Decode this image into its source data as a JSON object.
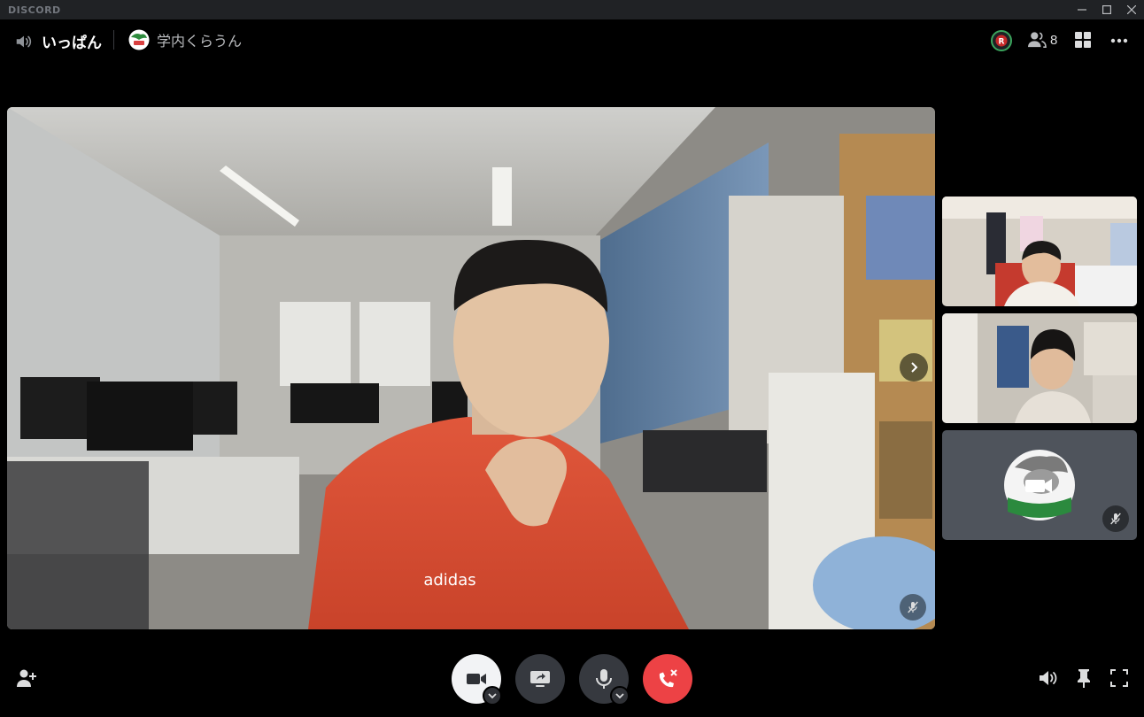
{
  "app": {
    "brand": "DISCORD"
  },
  "header": {
    "channel_name": "いっぱん",
    "server_name": "学内くらうん",
    "participant_count": "8"
  },
  "stage": {
    "focused_participant": "main-video",
    "thumbnails": [
      "participant-1",
      "participant-2",
      "participant-3-camera-off"
    ]
  },
  "controls": {
    "camera": "camera-icon",
    "screen_share": "screen-share-icon",
    "microphone": "microphone-icon",
    "disconnect": "disconnect-icon"
  },
  "colors": {
    "accent_red": "#ed4245",
    "ui_dark": "#36393f",
    "titlebar": "#202225",
    "live_green": "#3ba55d"
  }
}
